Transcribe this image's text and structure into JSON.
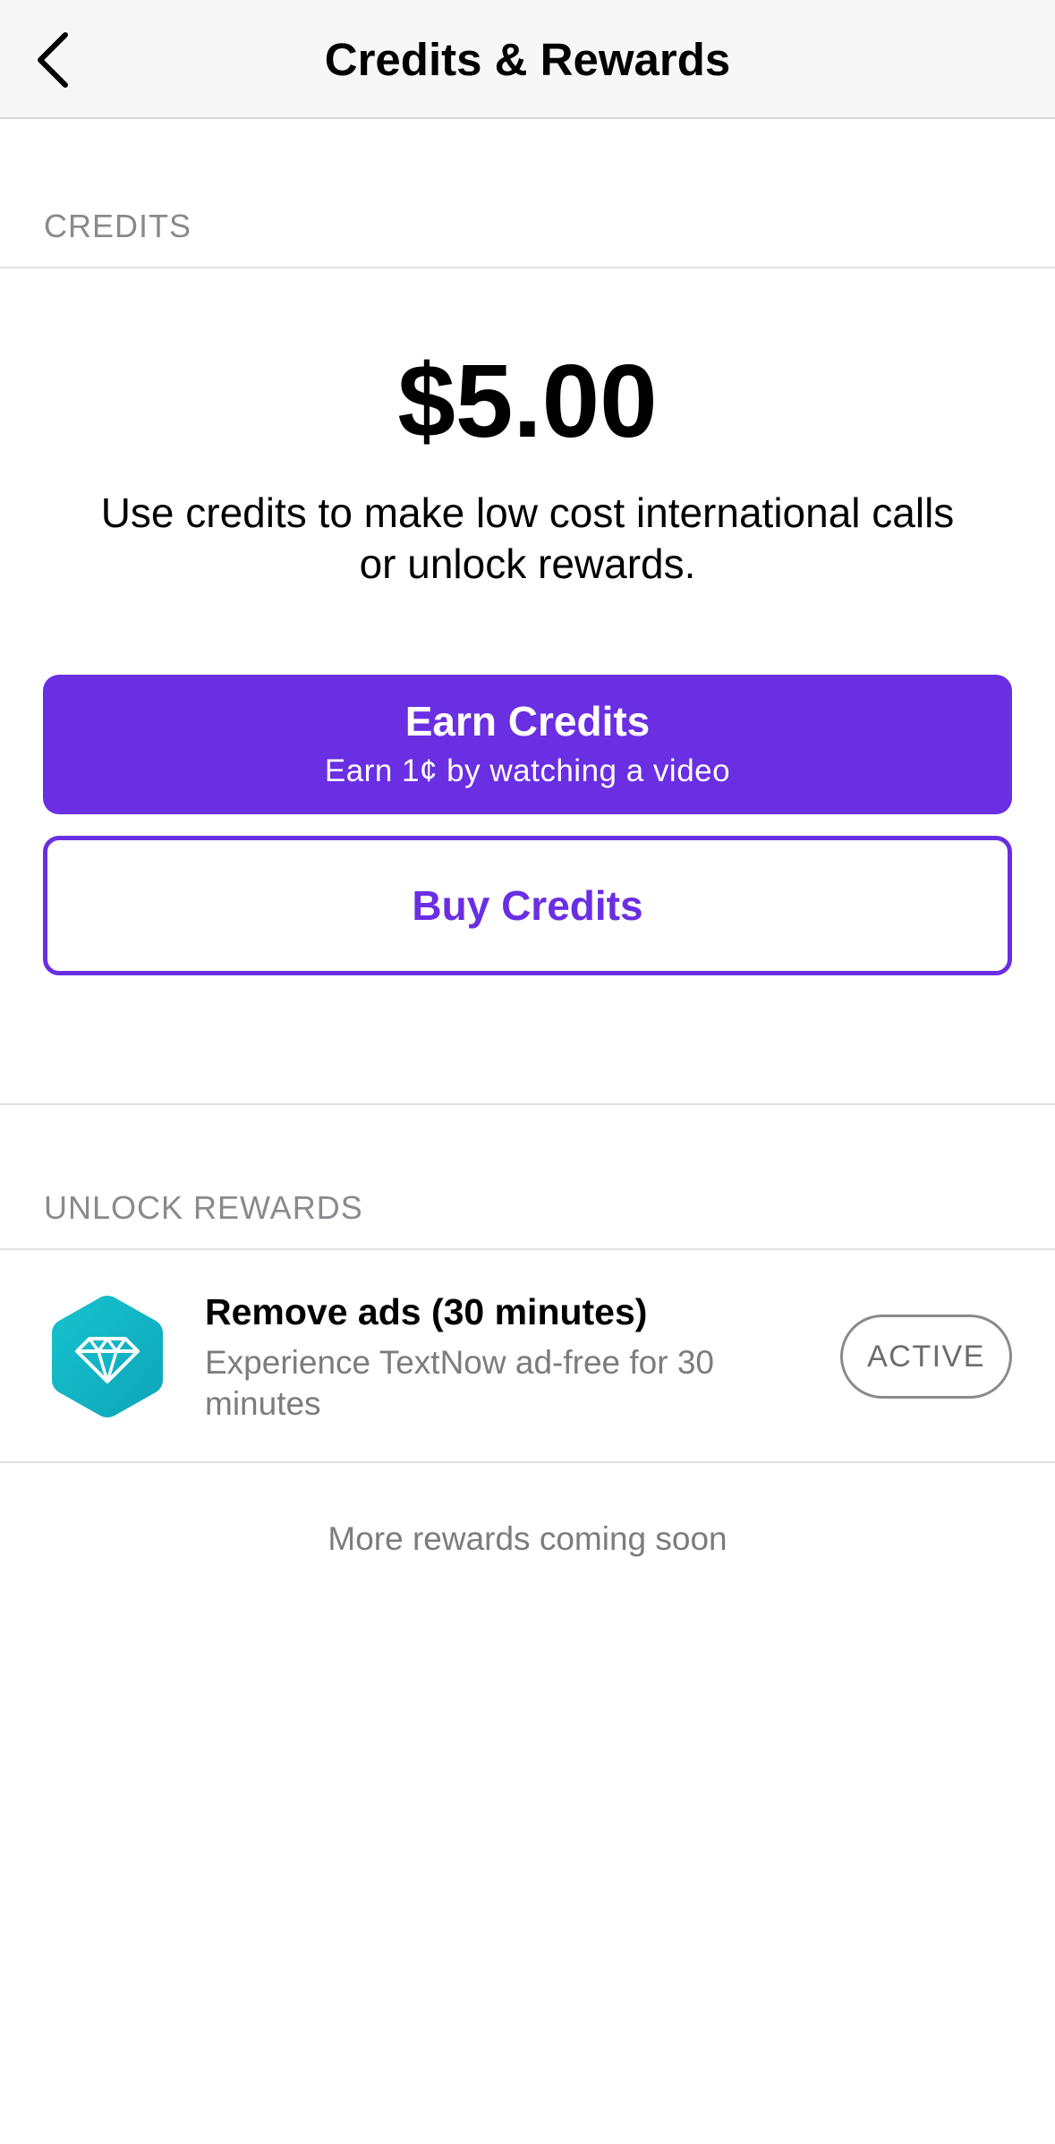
{
  "nav": {
    "title": "Credits & Rewards",
    "back_icon": "chevron-left-icon"
  },
  "credits_section": {
    "header": "CREDITS",
    "amount": "$5.00",
    "description": "Use credits to make low cost international calls or unlock rewards.",
    "earn_button": {
      "title": "Earn Credits",
      "subtitle": "Earn 1¢ by watching a video"
    },
    "buy_button": {
      "label": "Buy Credits"
    }
  },
  "rewards_section": {
    "header": "UNLOCK REWARDS",
    "items": [
      {
        "icon": "diamond-icon",
        "title": "Remove ads (30 minutes)",
        "description": "Experience TextNow ad-free for 30 minutes",
        "status": "ACTIVE"
      }
    ],
    "footer": "More rewards coming soon"
  },
  "colors": {
    "accent": "#6a2ee3",
    "reward_icon": "#14b8c6",
    "secondary_text": "#7c7c80"
  }
}
